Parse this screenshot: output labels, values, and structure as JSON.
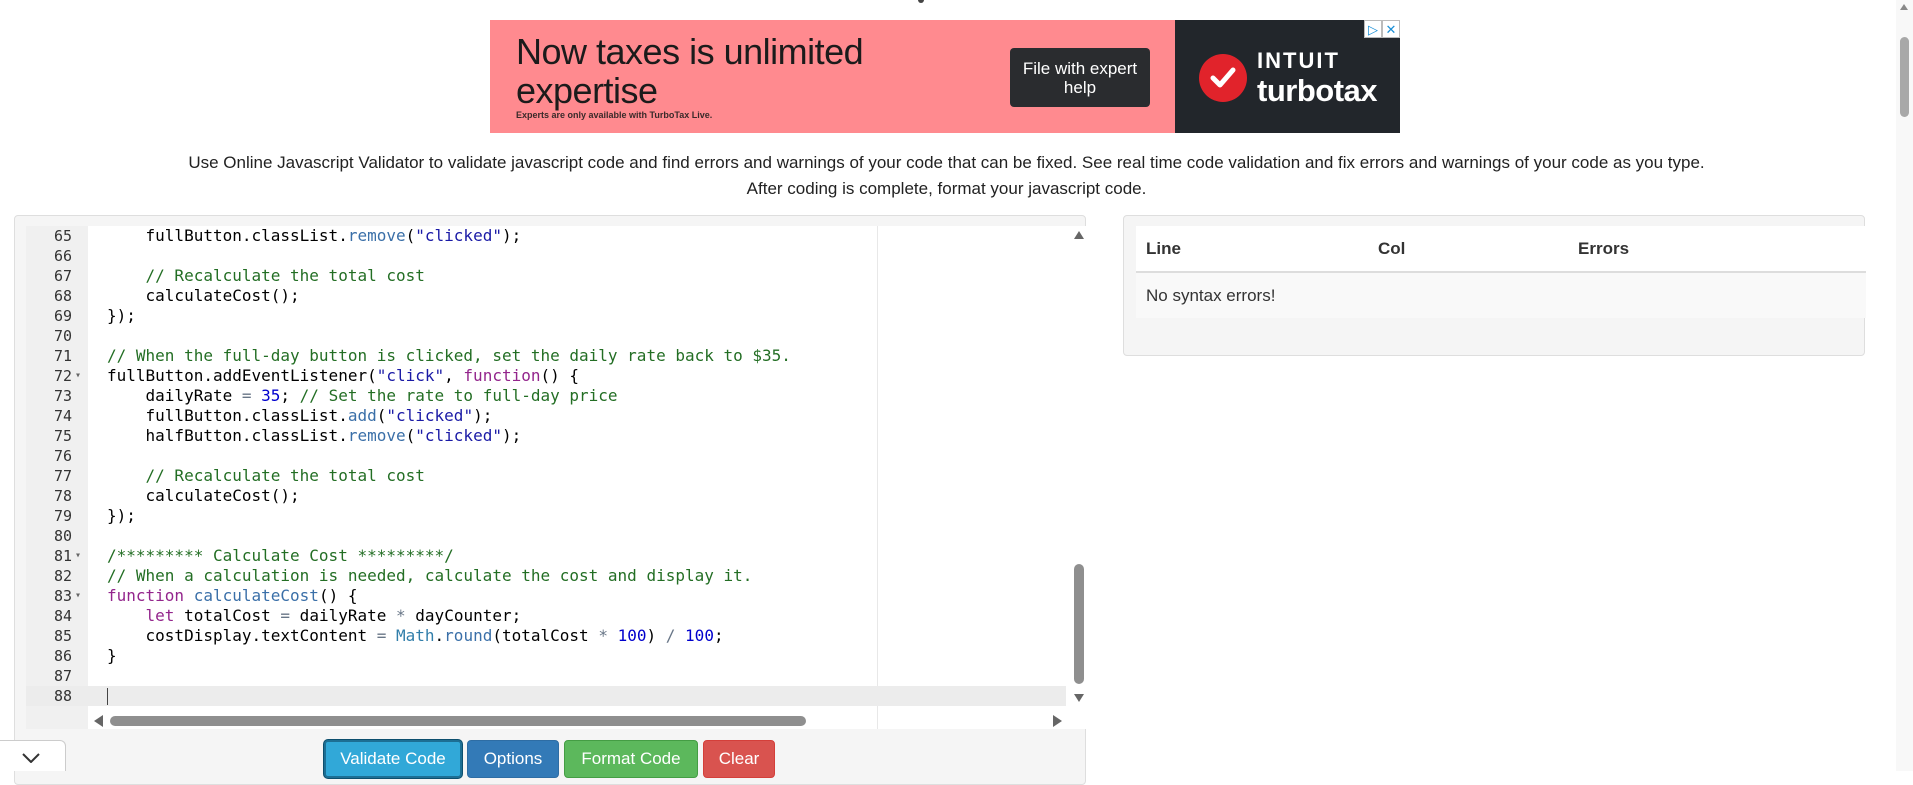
{
  "ad": {
    "headline": "Now taxes is unlimited expertise",
    "fine_print": "Experts are only available with TurboTax Live.",
    "cta": "File with expert help",
    "brand_line1": "INTUIT",
    "brand_line2": "turbotax",
    "ad_choices_icon": "ad-choices-icon",
    "close_icon": "close-icon",
    "colors": {
      "left_bg": "#ff8a8f",
      "right_bg": "#22262b",
      "check": "#e1232b"
    }
  },
  "description": "Use Online Javascript Validator to validate javascript code and find errors and warnings of your code that can be fixed. See real time code validation and fix errors and warnings of your code as you type. After coding is complete, format your javascript code.",
  "editor": {
    "lines": [
      {
        "num": "65",
        "fold": "",
        "code": "    fullButton.classList.remove(\"clicked\");"
      },
      {
        "num": "66",
        "fold": "",
        "code": ""
      },
      {
        "num": "67",
        "fold": "",
        "code": "    // Recalculate the total cost"
      },
      {
        "num": "68",
        "fold": "",
        "code": "    calculateCost();"
      },
      {
        "num": "69",
        "fold": "",
        "code": "});"
      },
      {
        "num": "70",
        "fold": "",
        "code": ""
      },
      {
        "num": "71",
        "fold": "",
        "code": "// When the full-day button is clicked, set the daily rate back to $35."
      },
      {
        "num": "72",
        "fold": "▾",
        "code": "fullButton.addEventListener(\"click\", function() {"
      },
      {
        "num": "73",
        "fold": "",
        "code": "    dailyRate = 35; // Set the rate to full-day price"
      },
      {
        "num": "74",
        "fold": "",
        "code": "    fullButton.classList.add(\"clicked\");"
      },
      {
        "num": "75",
        "fold": "",
        "code": "    halfButton.classList.remove(\"clicked\");"
      },
      {
        "num": "76",
        "fold": "",
        "code": ""
      },
      {
        "num": "77",
        "fold": "",
        "code": "    // Recalculate the total cost"
      },
      {
        "num": "78",
        "fold": "",
        "code": "    calculateCost();"
      },
      {
        "num": "79",
        "fold": "",
        "code": "});"
      },
      {
        "num": "80",
        "fold": "",
        "code": ""
      },
      {
        "num": "81",
        "fold": "▾",
        "code": "/********* Calculate Cost *********/"
      },
      {
        "num": "82",
        "fold": "",
        "code": "// When a calculation is needed, calculate the cost and display it."
      },
      {
        "num": "83",
        "fold": "▾",
        "code": "function calculateCost() {"
      },
      {
        "num": "84",
        "fold": "",
        "code": "    let totalCost = dailyRate * dayCounter;"
      },
      {
        "num": "85",
        "fold": "",
        "code": "    costDisplay.textContent = Math.round(totalCost * 100) / 100;"
      },
      {
        "num": "86",
        "fold": "",
        "code": "}"
      },
      {
        "num": "87",
        "fold": "",
        "code": ""
      },
      {
        "num": "88",
        "fold": "",
        "code": ""
      }
    ],
    "active_line": "88"
  },
  "buttons": {
    "validate": "Validate Code",
    "options": "Options",
    "format": "Format Code",
    "clear": "Clear"
  },
  "results": {
    "columns": [
      "Line",
      "Col",
      "Errors"
    ],
    "message": "No syntax errors!"
  }
}
